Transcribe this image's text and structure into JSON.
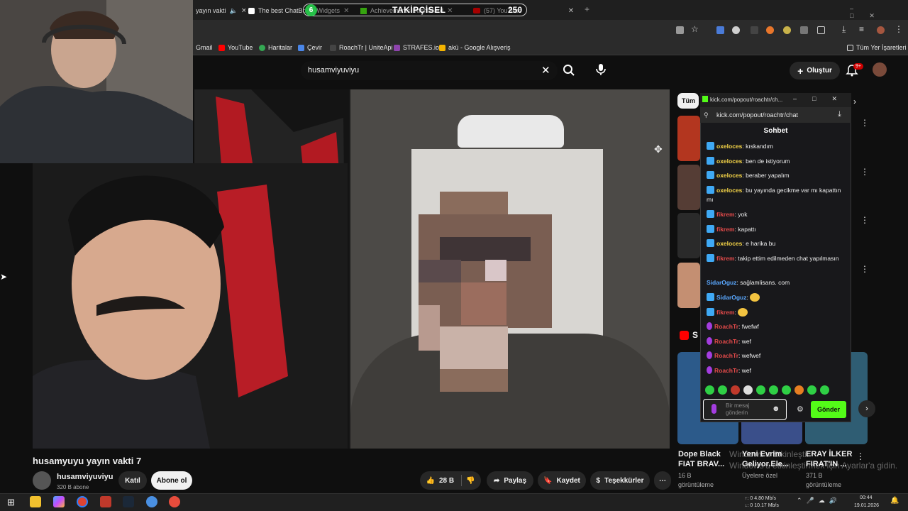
{
  "browser": {
    "tabs": [
      {
        "label": "yayın vakti"
      },
      {
        "label": "The best ChatBot ... Widgets"
      },
      {
        "label": "Achievements Dashboard"
      },
      {
        "label": "(57) YouTube"
      }
    ],
    "bookmarks": [
      "Gmail",
      "YouTube",
      "Haritalar",
      "Çevir",
      "RoachTr | UniteApi",
      "STRAFES.io",
      "akü - Google Alışveriş"
    ],
    "all_bookmarks": "Tüm Yer İşaretleri"
  },
  "overlay": {
    "badge": "6",
    "title": "TAKİPÇİSEL",
    "count": "250"
  },
  "youtube": {
    "search_value": "husamviyuviyu",
    "create_label": "Oluştur",
    "notifications": "9+",
    "filter_chip": "Tüm",
    "video_title": "husamyuyu yayın vakti 7",
    "channel_name": "husamviyuviyu",
    "channel_subs": "320 B abone",
    "join_label": "Katıl",
    "subscribe_label": "Abone ol",
    "likes": "28 B",
    "share_label": "Paylaş",
    "save_label": "Kaydet",
    "thanks_label": "Teşekkürler",
    "shorts_label": "S",
    "shorts": [
      {
        "title": "Dope Black FIAT BRAV...",
        "meta1": "16 B",
        "meta2": "görüntüleme"
      },
      {
        "title": "Yeni Evrim Geliyor.Ele...",
        "meta1": "Üyelere özel",
        "meta2": ""
      },
      {
        "title": "ERAY İLKER FIRAT'IN ...",
        "meta1": "371 B",
        "meta2": "görüntüleme"
      }
    ]
  },
  "kick": {
    "window_title": "kick.com/popout/roachtr/ch...",
    "url": "kick.com/popout/roachtr/chat",
    "chat_title": "Sohbet",
    "messages": [
      {
        "user": "oxeloces",
        "text": ": kıskandım"
      },
      {
        "user": "oxeloces",
        "text": ": ben de istiyorum"
      },
      {
        "user": "oxeloces",
        "text": ": beraber yapalım"
      },
      {
        "user": "oxeloces",
        "text": ": bu yayında gecikme var mı kapattın mı"
      },
      {
        "user": "fikrem",
        "text": ": yok"
      },
      {
        "user": "fikrem",
        "text": ": kapattı"
      },
      {
        "user": "oxeloces",
        "text": ": e harika bu"
      },
      {
        "user": "fikrem",
        "text": ": takip ettim edilmeden chat yapılmasın"
      },
      {
        "user": "SidarOguz",
        "text": ": sağlamlisans. com"
      },
      {
        "user": "SidarOguz",
        "text": ":"
      },
      {
        "user": "fikrem",
        "text": ":"
      },
      {
        "user": "RoachTr",
        "text": ": fwefwf"
      },
      {
        "user": "RoachTr",
        "text": ": wef"
      },
      {
        "user": "RoachTr",
        "text": ": wefwef"
      },
      {
        "user": "RoachTr",
        "text": ": wef"
      }
    ],
    "input_placeholder": "Bir mesaj gönderin",
    "send_label": "Gönder"
  },
  "watermark": "Windows'u Etkinleştir\nWindows'u etkinleştirmek için Ayarlar'a gidin.",
  "system": {
    "net_up": "↑: 0 4.80 Mb/s",
    "net_down": "↓: 0 10.17 Mb/s",
    "time": "00:44",
    "date": "19.01.2026"
  },
  "colors": {
    "kick_green": "#53fc18",
    "yt_red": "#ff0000",
    "notif_red": "#cc0000"
  }
}
